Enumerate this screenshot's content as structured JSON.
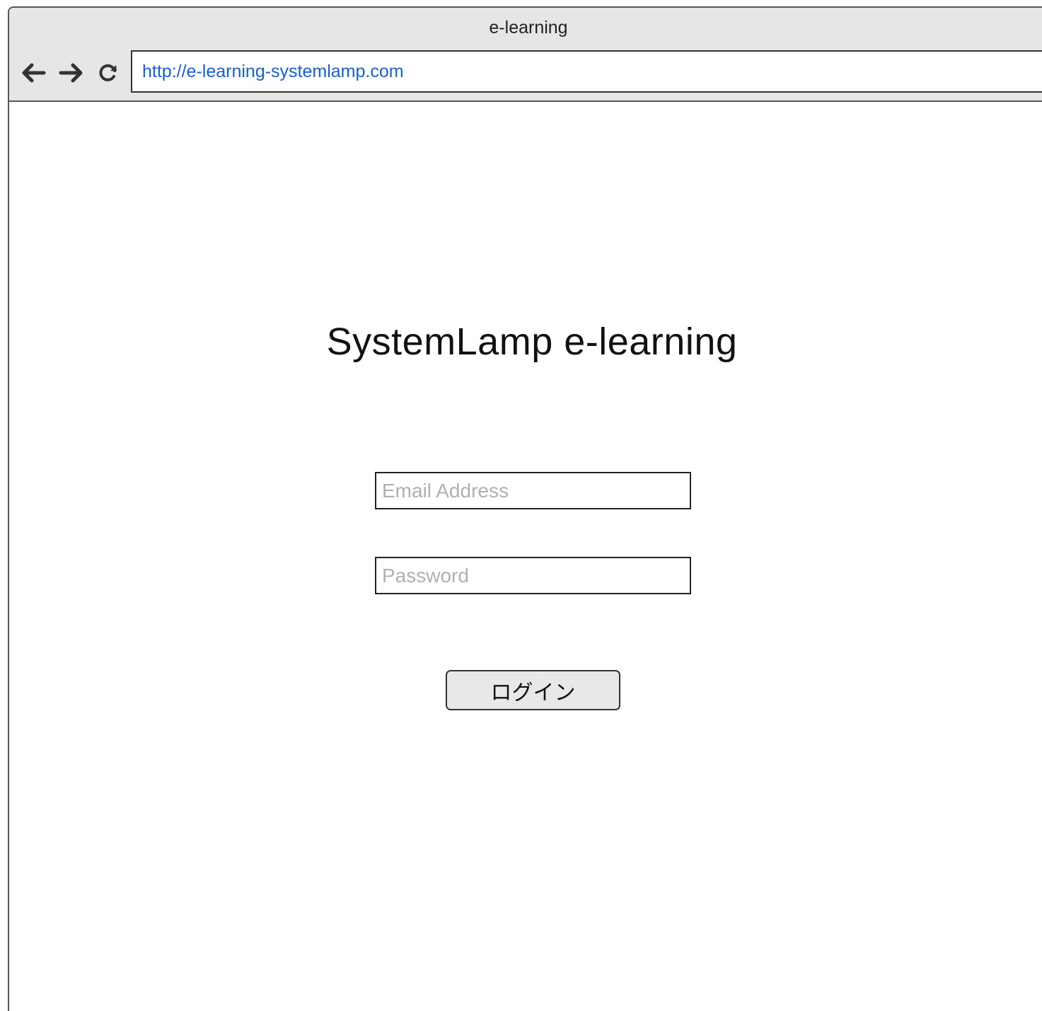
{
  "window": {
    "title": "e-learning"
  },
  "toolbar": {
    "back_icon": "arrow-left-icon",
    "forward_icon": "arrow-right-icon",
    "reload_icon": "reload-icon",
    "url": "http://e-learning-systemlamp.com",
    "url_color": "#1a5fd6"
  },
  "login": {
    "title": "SystemLamp e-learning",
    "email_placeholder": "Email Address",
    "password_placeholder": "Password",
    "submit_label": "ログイン"
  }
}
